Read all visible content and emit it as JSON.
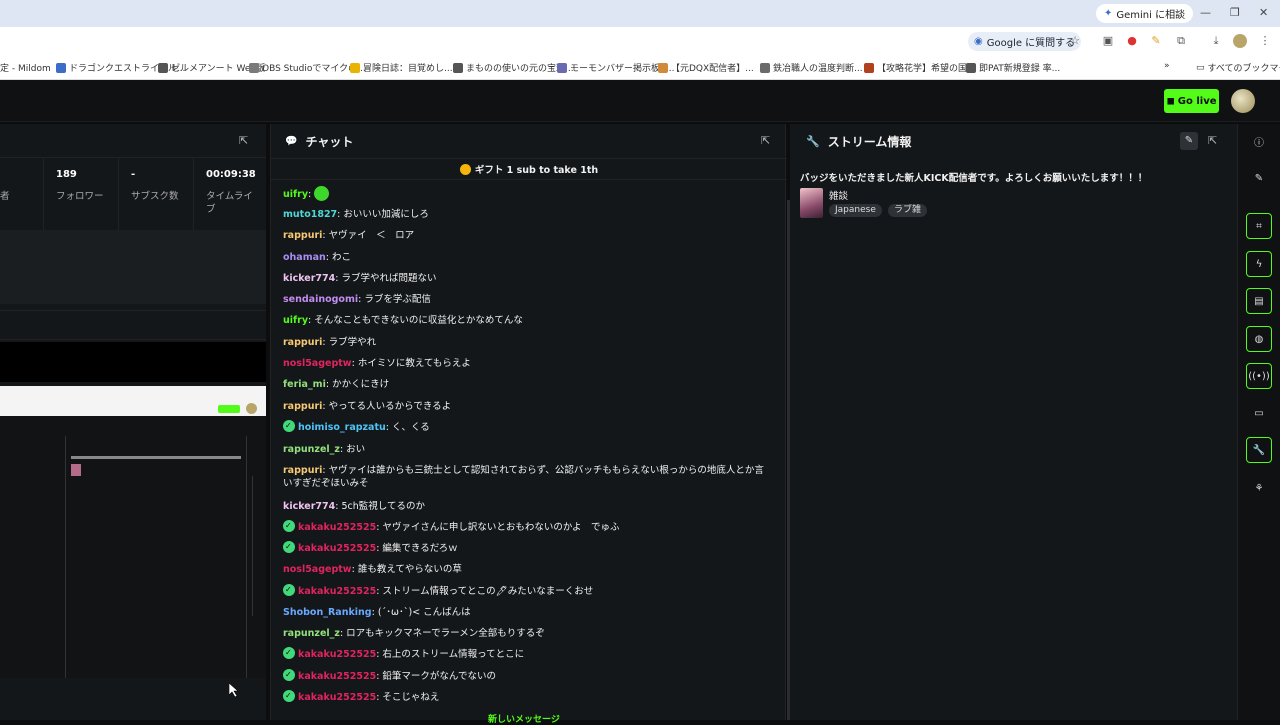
{
  "browser": {
    "gemini_label": "Gemini に相談",
    "google_label": "Google に質問する",
    "bookmarks": [
      {
        "label": "定 - Mildom",
        "color": "#666"
      },
      {
        "label": "ドラゴンクエストライバル...",
        "color": "#3b6cc7"
      },
      {
        "label": "ゼルメアンート Web版",
        "color": "#555"
      },
      {
        "label": "OBS Studioでマイクの...",
        "color": "#7a7a7a"
      },
      {
        "label": "冒険日誌：目覚めし...",
        "color": "#e8b400"
      },
      {
        "label": "まものの使いの元の宝珠...",
        "color": "#555"
      },
      {
        "label": "モーモンバザー掲示板 |...",
        "color": "#6a6ab0"
      },
      {
        "label": "【元DQX配信者】...",
        "color": "#d08a3a"
      },
      {
        "label": "鉄冶職人の温度判断...",
        "color": "#6a6a6a"
      },
      {
        "label": "【攻略花学】希望の国...",
        "color": "#b0401e"
      },
      {
        "label": "即PAT新規登録 率...",
        "color": "#555"
      }
    ],
    "bookmarks_all": "すべてのブックマーク"
  },
  "header": {
    "go_live": "Go live"
  },
  "stats": [
    {
      "value": "",
      "label": "者"
    },
    {
      "value": "189",
      "label": "フォロワー"
    },
    {
      "value": "-",
      "label": "サブスク数"
    },
    {
      "value": "00:09:38",
      "label": "タイムライブ"
    }
  ],
  "chat": {
    "title": "チャット",
    "gift_banner": "ギフト 1 sub to take 1th",
    "new_messages": "新しいメッセージ",
    "messages": [
      {
        "user": "uifry",
        "color": "#53fc18",
        "text": "",
        "emote": true,
        "badge": false
      },
      {
        "user": "muto1827",
        "color": "#4fd6d6",
        "text": ": おいいい加減にしろ",
        "badge": false
      },
      {
        "user": "rappuri",
        "color": "#f7c873",
        "text": ": ヤヴァイ　＜　ロア",
        "badge": false
      },
      {
        "user": "ohaman",
        "color": "#a98cf2",
        "text": ": わこ",
        "badge": false
      },
      {
        "user": "kicker774",
        "color": "#f0c3f0",
        "text": ": ラブ学やれば問題ない",
        "badge": false
      },
      {
        "user": "sendainogomi",
        "color": "#c08cf2",
        "text": ": ラブを学ぶ配信",
        "badge": false
      },
      {
        "user": "uifry",
        "color": "#53fc18",
        "text": ": そんなこともできないのに収益化とかなめてんな",
        "badge": false
      },
      {
        "user": "rappuri",
        "color": "#f7c873",
        "text": ": ラブ学やれ",
        "badge": false
      },
      {
        "user": "nosl5ageptw",
        "color": "#e0245e",
        "text": ": ホイミソに教えてもらえよ",
        "badge": false
      },
      {
        "user": "feria_mi",
        "color": "#93e07d",
        "text": ": かかくにきけ",
        "badge": false
      },
      {
        "user": "rappuri",
        "color": "#f7c873",
        "text": ": やってる人いるからできるよ",
        "badge": false
      },
      {
        "user": "hoimiso_rapzatu",
        "color": "#4fc3f7",
        "text": ": く、くる",
        "badge": true
      },
      {
        "user": "rapunzel_z",
        "color": "#93e07d",
        "text": ": おい",
        "badge": false
      },
      {
        "user": "rappuri",
        "color": "#f7c873",
        "text": ": ヤヴァイは誰からも三銃士として認知されておらず、公認バッチももらえない根っからの地底人とか言いすぎだぞほいみそ",
        "badge": false,
        "wrap": true
      },
      {
        "user": "kicker774",
        "color": "#f0c3f0",
        "text": ": 5ch監視してるのか",
        "badge": false
      },
      {
        "user": "kakaku252525",
        "color": "#e0245e",
        "text": ": ヤヴァイさんに申し訳ないとおもわないのかよ　でゅふ",
        "badge": true
      },
      {
        "user": "kakaku252525",
        "color": "#e0245e",
        "text": ": 編集できるだろｗ",
        "badge": true
      },
      {
        "user": "nosl5ageptw",
        "color": "#e0245e",
        "text": ": 誰も教えてやらないの草",
        "badge": false
      },
      {
        "user": "kakaku252525",
        "color": "#e0245e",
        "text": ": ストリーム情報ってとこの🖊みたいなまーくおせ",
        "badge": true
      },
      {
        "user": "Shobon_Ranking",
        "color": "#6aa8ff",
        "text": ": (´･ω･`)< こんばんは",
        "badge": false
      },
      {
        "user": "rapunzel_z",
        "color": "#93e07d",
        "text": ": ロアもキックマネーでラーメン全部もりするぞ",
        "badge": false
      },
      {
        "user": "kakaku252525",
        "color": "#e0245e",
        "text": ": 右上のストリーム情報ってとこに",
        "badge": true
      },
      {
        "user": "kakaku252525",
        "color": "#e0245e",
        "text": ": 鉛筆マークがなんでないの",
        "badge": true
      },
      {
        "user": "kakaku252525",
        "color": "#e0245e",
        "text": ": そこじゃねえ",
        "badge": true
      }
    ]
  },
  "stream_info": {
    "title": "ストリーム情報",
    "description": "バッジをいただきました新人KICK配信者です。よろしくお願いいたします！！！",
    "category": "雑談",
    "tags": [
      "Japanese",
      "ラブ雑"
    ]
  },
  "toolbar": {
    "items": [
      "info-icon",
      "pencil-icon",
      "scan-icon",
      "bolt-icon",
      "document-icon",
      "chat-icon",
      "broadcast-icon",
      "layers-icon",
      "wrench-icon",
      "share-icon"
    ]
  }
}
